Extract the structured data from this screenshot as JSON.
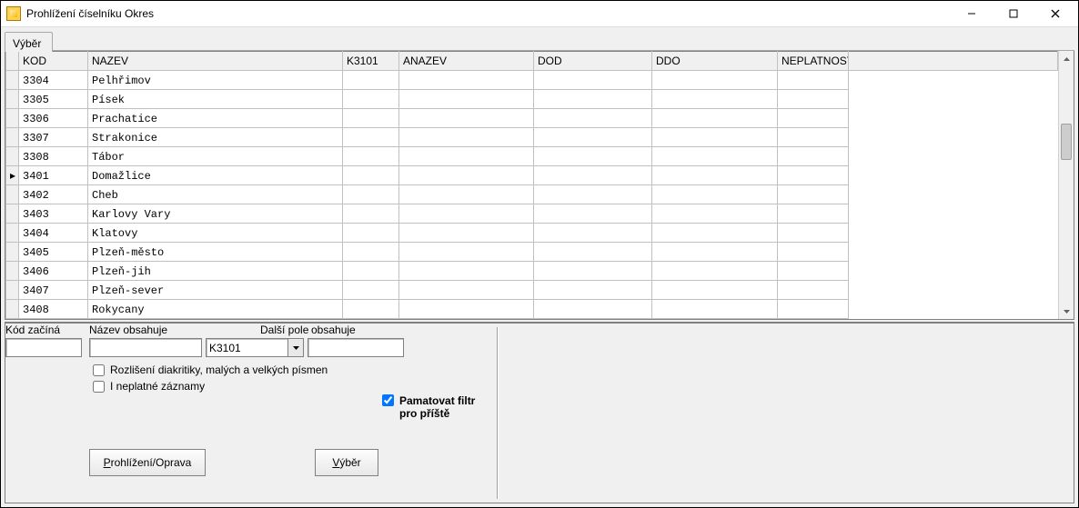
{
  "window": {
    "title": "Prohlížení číselníku Okres"
  },
  "tabs": {
    "active": "Výběr"
  },
  "grid": {
    "columns": {
      "kod": "KOD",
      "nazev": "NAZEV",
      "k3101": "K3101",
      "anazev": "ANAZEV",
      "dod": "DOD",
      "ddo": "DDO",
      "neplatnost": "NEPLATNOST"
    },
    "current_row_index": 5,
    "rows": [
      {
        "kod": "3304",
        "nazev": "Pelhřimov"
      },
      {
        "kod": "3305",
        "nazev": "Písek"
      },
      {
        "kod": "3306",
        "nazev": "Prachatice"
      },
      {
        "kod": "3307",
        "nazev": "Strakonice"
      },
      {
        "kod": "3308",
        "nazev": "Tábor"
      },
      {
        "kod": "3401",
        "nazev": "Domažlice"
      },
      {
        "kod": "3402",
        "nazev": "Cheb"
      },
      {
        "kod": "3403",
        "nazev": "Karlovy Vary"
      },
      {
        "kod": "3404",
        "nazev": "Klatovy"
      },
      {
        "kod": "3405",
        "nazev": "Plzeň-město"
      },
      {
        "kod": "3406",
        "nazev": "Plzeň-jih"
      },
      {
        "kod": "3407",
        "nazev": "Plzeň-sever"
      },
      {
        "kod": "3408",
        "nazev": "Rokycany"
      }
    ]
  },
  "form": {
    "labels": {
      "kod_zacina": "Kód začíná",
      "nazev_obsahuje": "Název obsahuje",
      "dalsi_pole": "Další pole",
      "obsahuje": "obsahuje"
    },
    "dalsi_pole_value": "K3101",
    "checkboxes": {
      "diakritika": {
        "label": "Rozlišení diakritiky, malých a velkých písmen",
        "checked": false
      },
      "neplatne": {
        "label": "I neplatné záznamy",
        "checked": false
      },
      "pamatovat": {
        "label_line1": "Pamatovat filtr",
        "label_line2": "pro příště",
        "checked": true
      }
    },
    "buttons": {
      "prohlizeni": "Prohlížení/Oprava",
      "vyber": "Výběr"
    }
  }
}
